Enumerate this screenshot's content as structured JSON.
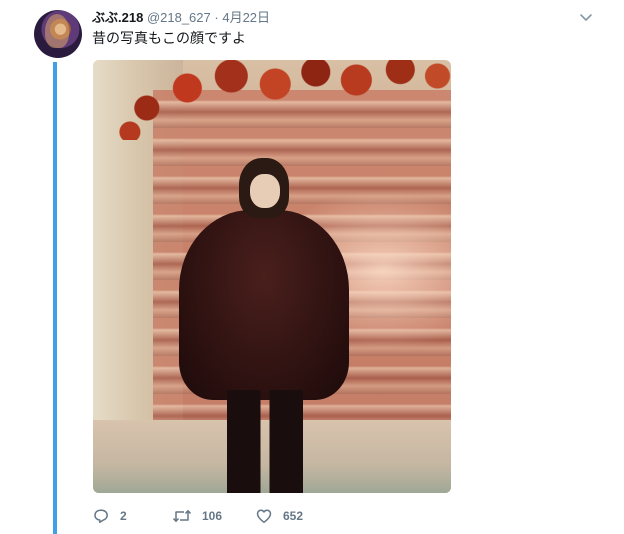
{
  "tweet": {
    "display_name": "ぶぶ.218",
    "handle": "@218_627",
    "separator": "·",
    "date": "4月22日",
    "text": "昔の写真もこの顔ですよ",
    "media_description": "photo-child-in-fur-coat"
  },
  "actions": {
    "reply_count": "2",
    "retweet_count": "106",
    "like_count": "652"
  },
  "icons": {
    "reply": "reply-icon",
    "retweet": "retweet-icon",
    "like": "heart-icon",
    "more": "chevron-down-icon"
  },
  "colors": {
    "thread_line": "#3fa0e8",
    "muted_text": "#657786",
    "text": "#14171a"
  }
}
